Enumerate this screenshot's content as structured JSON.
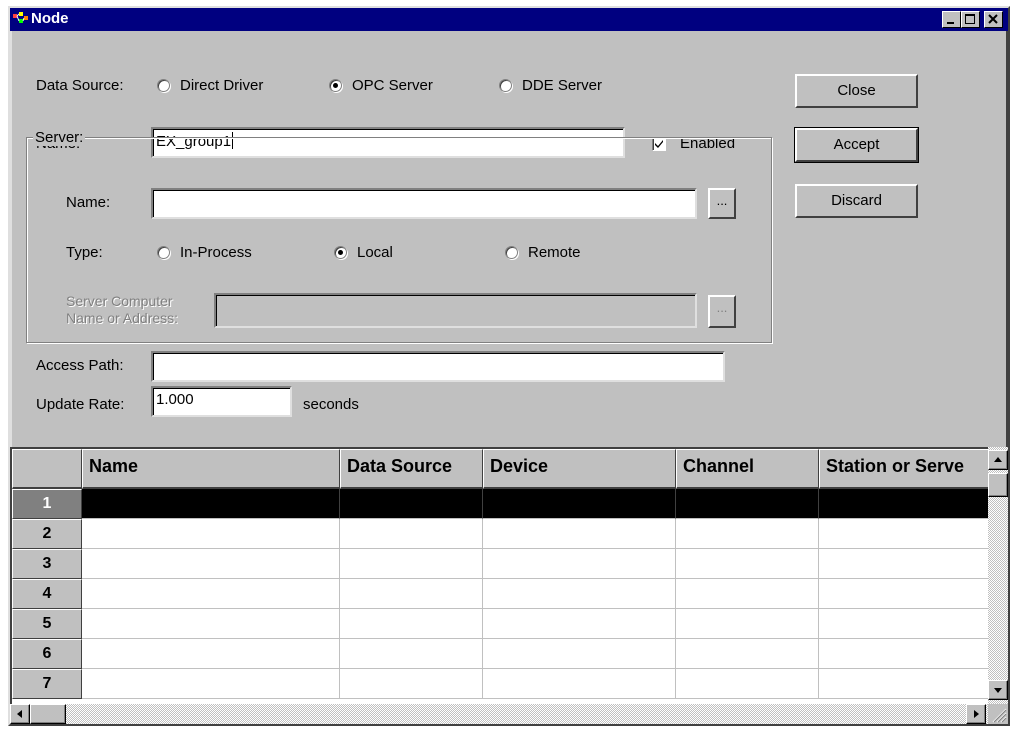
{
  "window": {
    "title": "Node",
    "icon": "node-app-icon",
    "controls": [
      "minimize-icon",
      "maximize-icon",
      "close-icon"
    ]
  },
  "form": {
    "data_source_label": "Data Source:",
    "data_source_options": [
      {
        "label": "Direct Driver",
        "selected": false
      },
      {
        "label": "OPC Server",
        "selected": true
      },
      {
        "label": "DDE Server",
        "selected": false
      }
    ],
    "name_label": "Name:",
    "name_value": "EX_group1",
    "enabled_label": "Enabled",
    "enabled_checked": true,
    "server_group_label": "Server:",
    "server_name_label": "Name:",
    "server_name_value": "",
    "browse_label": "...",
    "type_label": "Type:",
    "type_options": [
      {
        "label": "In-Process",
        "selected": false
      },
      {
        "label": "Local",
        "selected": true
      },
      {
        "label": "Remote",
        "selected": false
      }
    ],
    "server_computer_label_1": "Server Computer",
    "server_computer_label_2": "Name or Address:",
    "server_computer_value": "",
    "access_path_label": "Access Path:",
    "access_path_value": "",
    "update_rate_label": "Update Rate:",
    "update_rate_value": "1.000",
    "update_rate_units": "seconds"
  },
  "buttons": {
    "close": "Close",
    "accept": "Accept",
    "discard": "Discard"
  },
  "grid": {
    "columns": [
      "Name",
      "Data Source",
      "Device",
      "Channel",
      "Station or Serve"
    ],
    "rows": [
      "1",
      "2",
      "3",
      "4",
      "5",
      "6",
      "7"
    ],
    "selected_row": "1"
  },
  "colors": {
    "title_bar": "#000080",
    "face": "#c0c0c0",
    "selected_row": "#000000"
  }
}
